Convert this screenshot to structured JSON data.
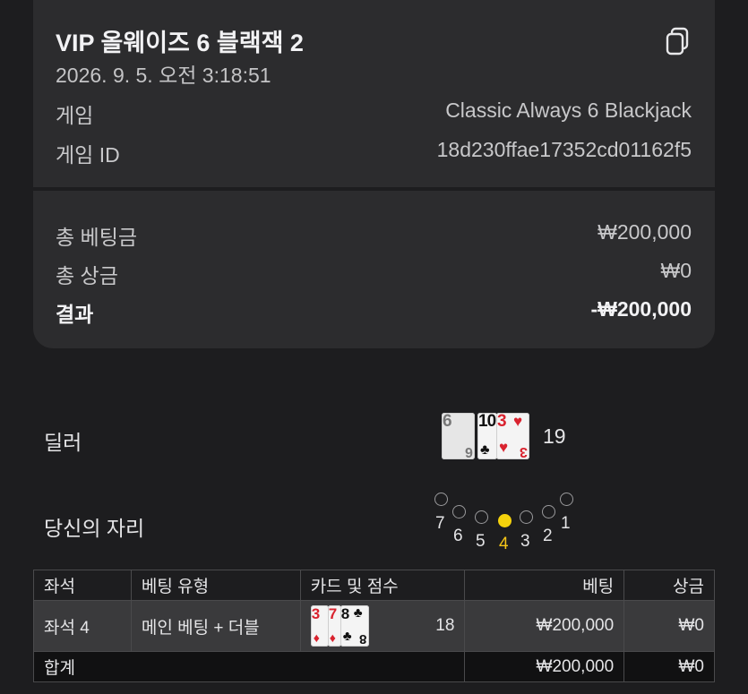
{
  "header": {
    "title": "VIP 올웨이즈 6 블랙잭 2",
    "datetime": "2026. 9. 5. 오전 3:18:51",
    "copy_icon": "copy-icon"
  },
  "info": {
    "game_label": "게임",
    "game_value": "Classic Always 6 Blackjack",
    "game_id_label": "게임 ID",
    "game_id_value": "18d230ffae17352cd01162f5"
  },
  "summary": {
    "total_bet_label": "총 베팅금",
    "total_bet_value": "₩200,000",
    "total_win_label": "총 상금",
    "total_win_value": "₩0",
    "result_label": "결과",
    "result_value": "-₩200,000"
  },
  "dealer": {
    "label": "딜러",
    "score": "19",
    "cards": [
      {
        "rank": "6",
        "suit": "♠",
        "color": "#111111",
        "face_down_style": true
      },
      {
        "rank": "10",
        "suit": "♣",
        "color": "#111111"
      },
      {
        "rank": "3",
        "suit": "♥",
        "color": "#d9232f"
      }
    ]
  },
  "seats": {
    "label": "당신의 자리",
    "numbers": [
      "7",
      "6",
      "5",
      "4",
      "3",
      "2",
      "1"
    ],
    "active": "4",
    "active_color": "#f5d20c"
  },
  "table": {
    "headers": [
      "좌석",
      "베팅 유형",
      "카드 및 점수",
      "베팅",
      "상금"
    ],
    "row": {
      "seat": "좌석 4",
      "bet_type": "메인 베팅 + 더블",
      "score": "18",
      "bet": "₩200,000",
      "win": "₩0",
      "cards": [
        {
          "rank": "3",
          "suit": "♦",
          "color": "#d9232f"
        },
        {
          "rank": "7",
          "suit": "♦",
          "color": "#d9232f"
        },
        {
          "rank": "8",
          "suit": "♣",
          "color": "#111111"
        }
      ]
    },
    "total": {
      "label": "합계",
      "bet": "₩200,000",
      "win": "₩0"
    }
  }
}
